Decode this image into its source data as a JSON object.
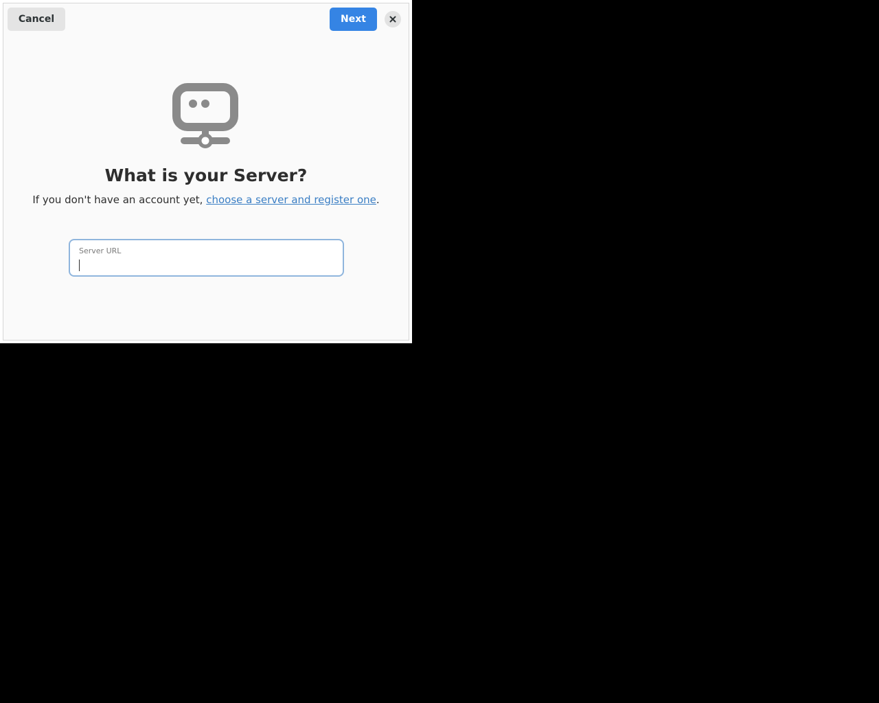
{
  "header": {
    "cancel_label": "Cancel",
    "next_label": "Next",
    "close_icon": "close-icon"
  },
  "main": {
    "icon": "network-server-icon",
    "title": "What is your Server?",
    "subtitle_prefix": "If you don't have an account yet, ",
    "subtitle_link": "choose a server and register one",
    "subtitle_suffix": "."
  },
  "server_url": {
    "label": "Server URL",
    "value": ""
  },
  "colors": {
    "accent": "#3584e4",
    "link": "#3a7ec4",
    "icon": "#8a8a8a",
    "desktop_background": "#000000"
  }
}
